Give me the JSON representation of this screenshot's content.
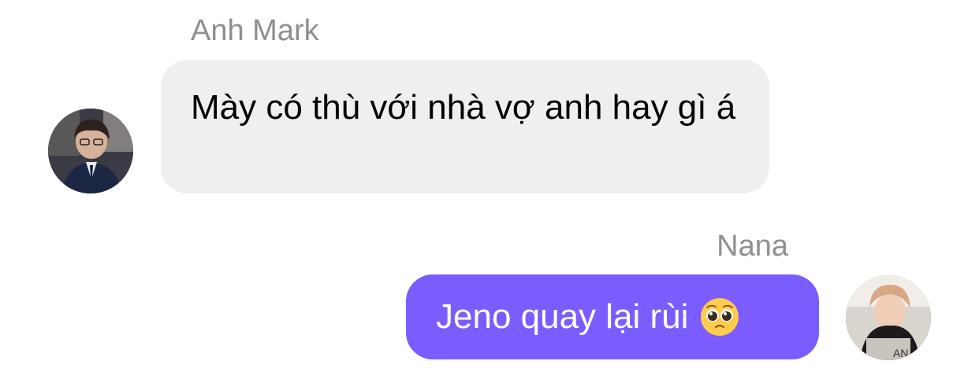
{
  "conversation": {
    "incoming": {
      "sender": "Anh Mark",
      "message": "Mày có thù với nhà vợ anh hay gì á"
    },
    "outgoing": {
      "sender": "Nana",
      "message": "Jeno quay lại rùi",
      "emoji": "pleading-face"
    }
  },
  "colors": {
    "incoming_bubble": "#efefef",
    "outgoing_bubble": "#7b5cff",
    "sender_name": "#8e8e93"
  }
}
